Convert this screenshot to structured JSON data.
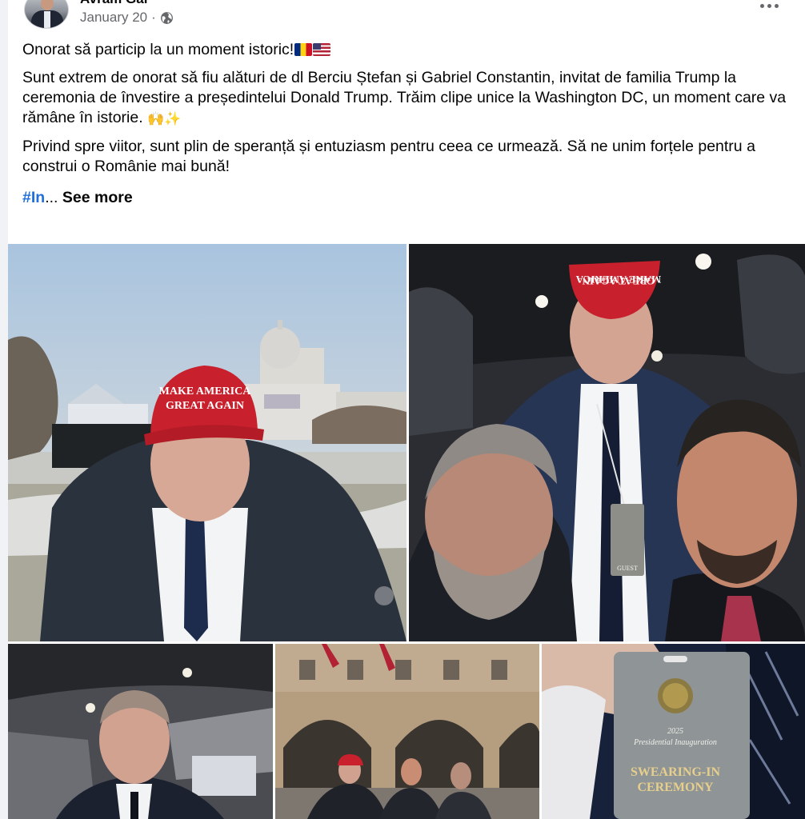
{
  "post": {
    "author": "Avram Gal",
    "date": "January 20",
    "separator": "·",
    "privacy_icon": "globe-icon",
    "menu_icon": "more-options-icon",
    "paragraphs": {
      "p1": "Onorat să particip la un moment istoric!",
      "p2": "Sunt extrem de onorat să fiu alături de dl Berciu Ștefan și Gabriel Constantin, invitat de familia Trump la ceremonia de învestire a președintelui Donald Trump. Trăim clipe unice la Washington DC, un moment care va rămâne în istorie.",
      "p2_emoji": "🙌✨",
      "p3": "Privind spre viitor, sunt plin de speranță și entuziasm pentru ceea ce urmează. Să ne unim forțele pentru a construi o Românie mai bună!"
    },
    "hashtag": "#In",
    "ellipsis": "...",
    "see_more": "See more"
  },
  "photos": {
    "hat_text_1": "MAKE AMERICA",
    "hat_text_2": "GREAT AGAIN",
    "badge_line_1": "SWEARING-IN",
    "badge_line_2": "CEREMONY",
    "badge_small_1": "2025",
    "badge_small_2": "Presidential Inauguration",
    "badge_guest": "GUEST"
  },
  "colors": {
    "link": "#216fdb",
    "muted": "#65676b",
    "text": "#050505",
    "hat_red": "#c8202c"
  }
}
